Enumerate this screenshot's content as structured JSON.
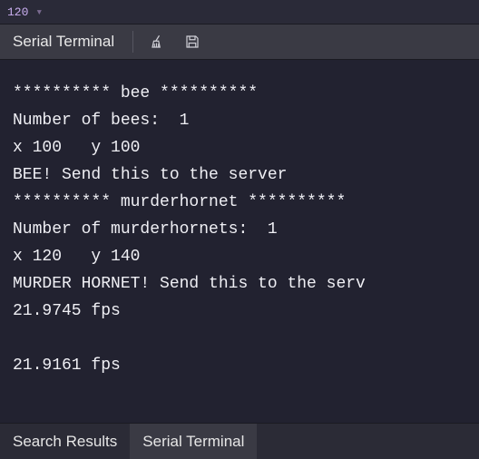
{
  "top": {
    "line_number": "120",
    "chevron": "▾"
  },
  "header": {
    "title": "Serial Terminal",
    "icons": {
      "clear": "broom-icon",
      "save": "save-icon"
    }
  },
  "terminal": {
    "lines": [
      "********** bee **********",
      "Number of bees:  1",
      "x 100   y 100",
      "BEE! Send this to the server",
      "********** murderhornet **********",
      "Number of murderhornets:  1",
      "x 120   y 140",
      "MURDER HORNET! Send this to the serv",
      "21.9745 fps",
      "",
      "21.9161 fps"
    ]
  },
  "tabs": {
    "items": [
      {
        "label": "Search Results",
        "active": false
      },
      {
        "label": "Serial Terminal",
        "active": true
      }
    ]
  }
}
